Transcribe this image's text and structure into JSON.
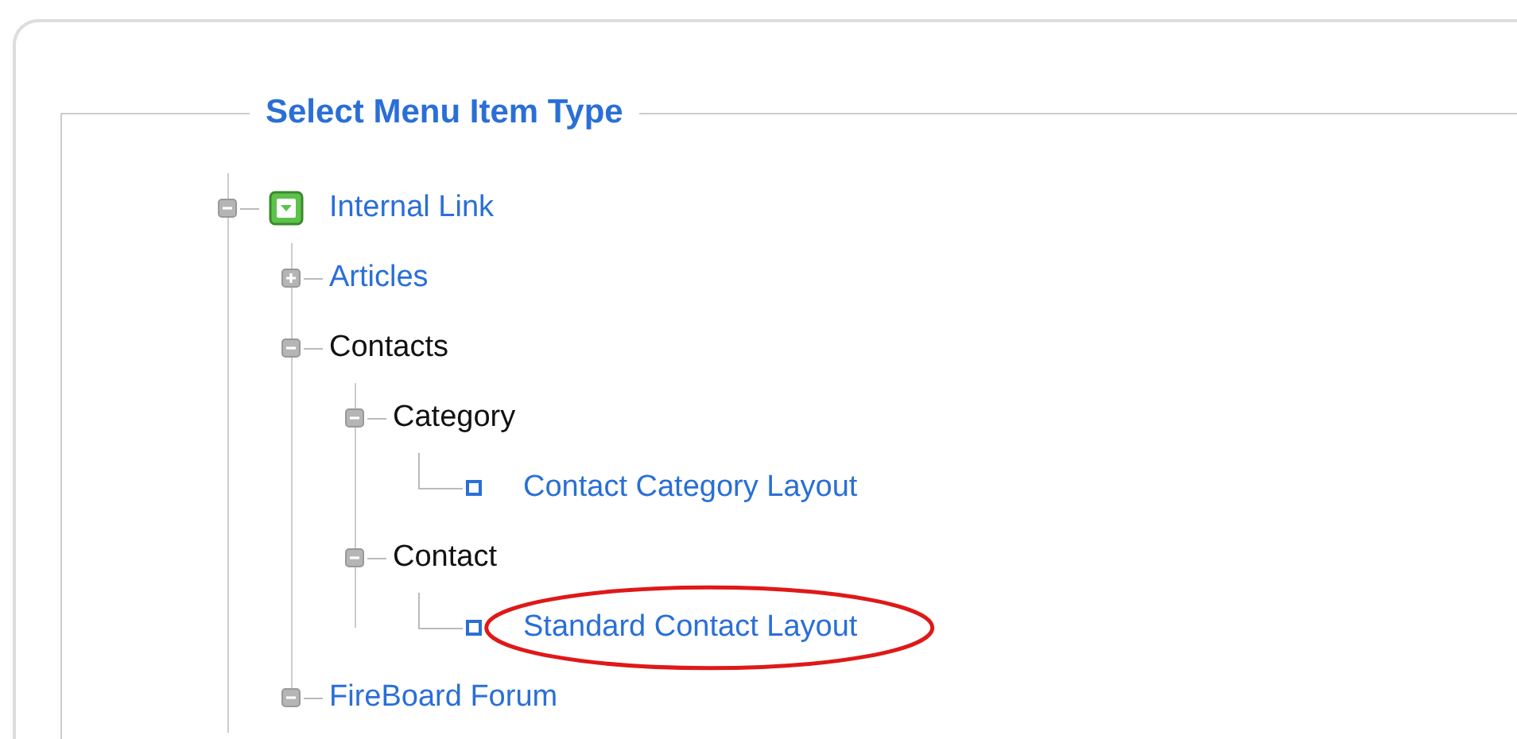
{
  "title": "Select Menu Item Type",
  "tree": [
    {
      "label": "Internal Link",
      "kind": "root",
      "linked": true,
      "expanded": true,
      "children": [
        {
          "label": "Articles",
          "kind": "branch",
          "linked": true,
          "expanded": false
        },
        {
          "label": "Contacts",
          "kind": "branch",
          "linked": false,
          "expanded": true,
          "children": [
            {
              "label": "Category",
              "kind": "branch",
              "linked": false,
              "expanded": true,
              "children": [
                {
                  "label": "Contact Category Layout",
                  "kind": "leaf",
                  "circled": false
                }
              ]
            },
            {
              "label": "Contact",
              "kind": "branch",
              "linked": false,
              "expanded": true,
              "children": [
                {
                  "label": "Standard Contact Layout",
                  "kind": "leaf",
                  "circled": true
                }
              ]
            }
          ]
        },
        {
          "label": "FireBoard Forum",
          "kind": "branch",
          "linked": true,
          "expanded": true
        }
      ]
    }
  ]
}
